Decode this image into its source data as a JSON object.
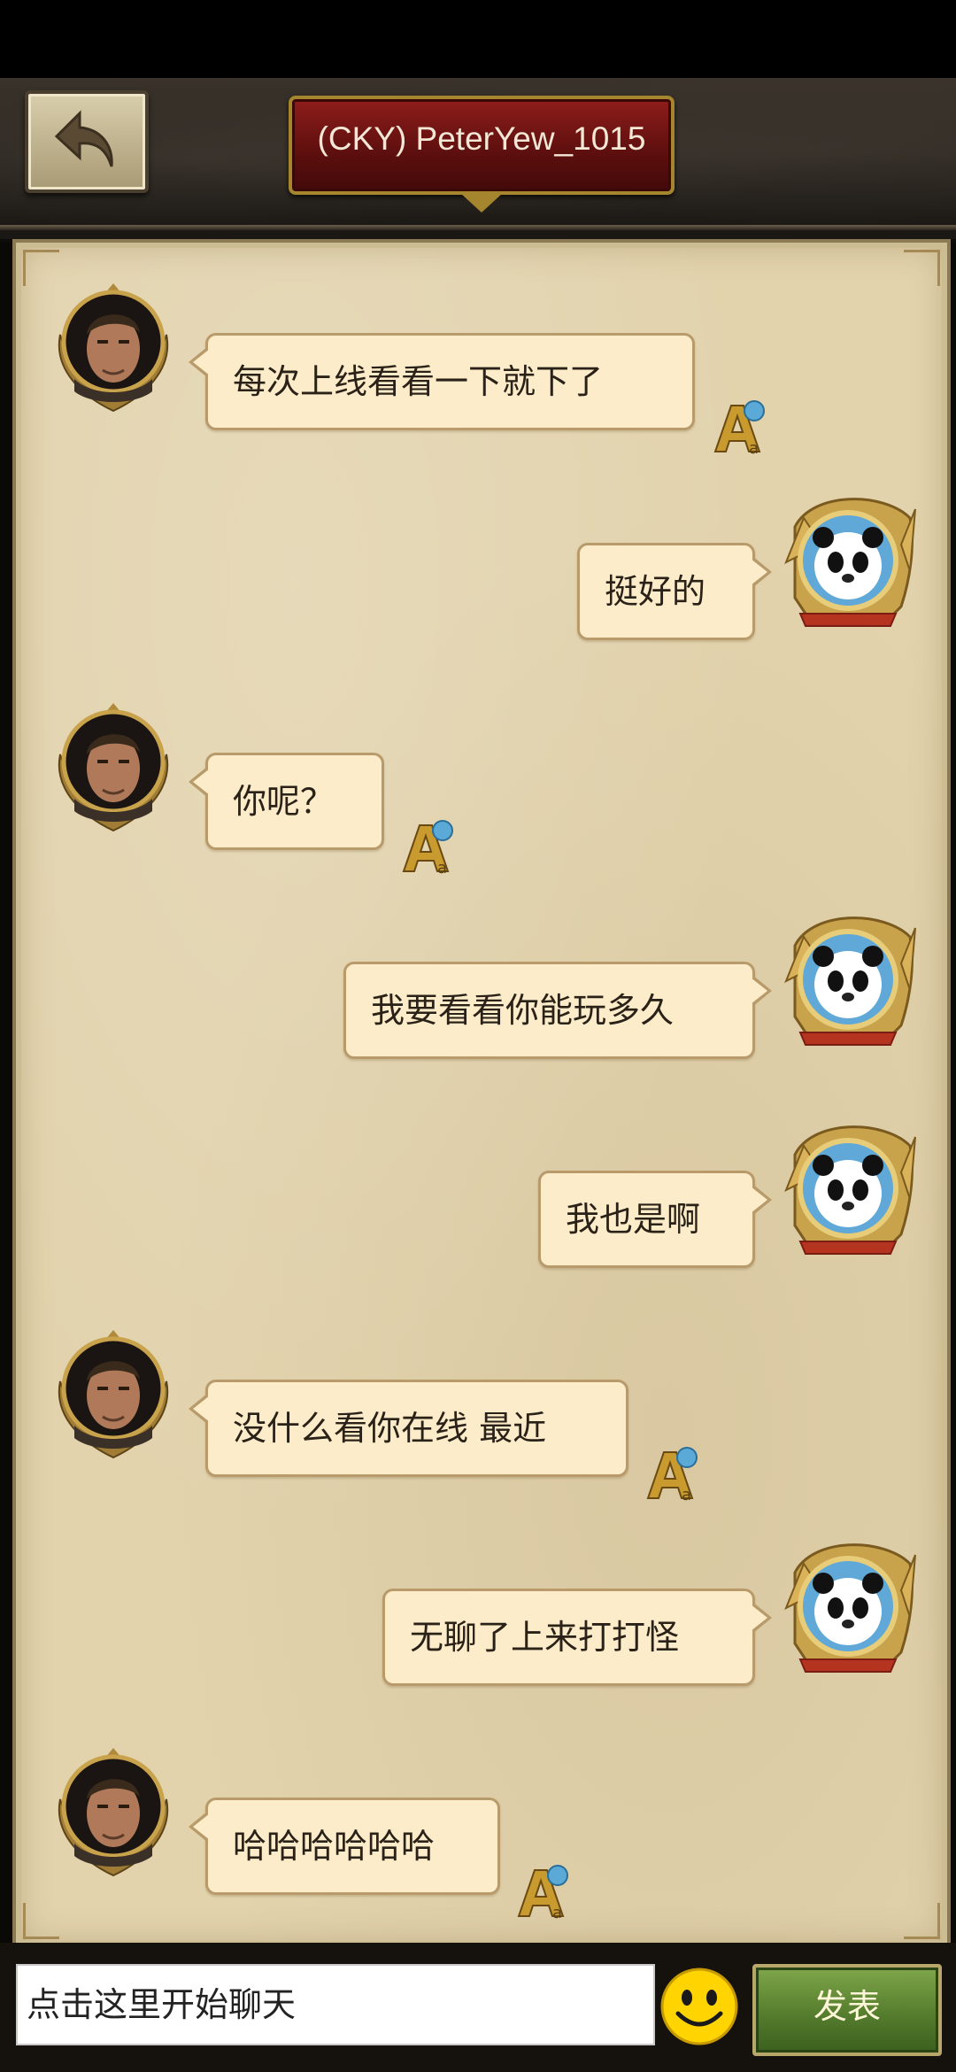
{
  "header": {
    "title": "(CKY) PeterYew_1015"
  },
  "messages": [
    {
      "side": "left",
      "text": "每次上线看看一下就下了"
    },
    {
      "side": "right",
      "text": "挺好的"
    },
    {
      "side": "left",
      "text": "你呢？"
    },
    {
      "side": "right",
      "text": "我要看看你能玩多久"
    },
    {
      "side": "right",
      "text": "我也是啊"
    },
    {
      "side": "left",
      "text": "没什么看你在线 最近"
    },
    {
      "side": "right",
      "text": "无聊了上来打打怪"
    },
    {
      "side": "left",
      "text": "哈哈哈哈哈哈"
    }
  ],
  "input": {
    "placeholder": "点击这里开始聊天",
    "send_label": "发表"
  },
  "icons": {
    "back": "back-arrow-icon",
    "emoji": "smiley-icon",
    "font": "font-size-icon",
    "left_avatar": "warrior-portrait",
    "right_avatar": "panda-portrait"
  },
  "colors": {
    "bubble": "#fcecc9",
    "panel": "#e2d3ad",
    "title_plate": "#7a1816",
    "send": "#557d2d"
  }
}
